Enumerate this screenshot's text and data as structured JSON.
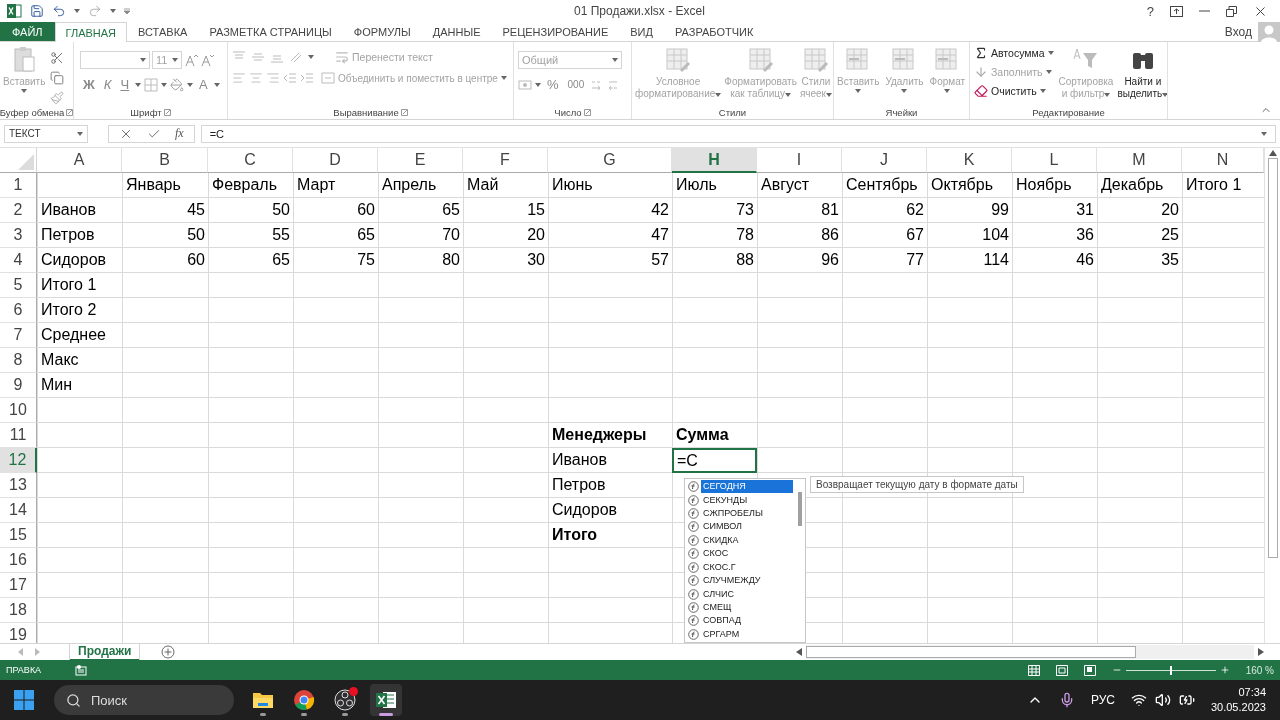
{
  "window": {
    "title": "01 Продажи.xlsx - Excel",
    "help": "?"
  },
  "ribbon_tabs": [
    {
      "label": "ФАЙЛ",
      "kind": "file",
      "selected": false
    },
    {
      "label": "ГЛАВНАЯ",
      "kind": "tab",
      "selected": true
    },
    {
      "label": "ВСТАВКА",
      "kind": "tab",
      "selected": false
    },
    {
      "label": "РАЗМЕТКА СТРАНИЦЫ",
      "kind": "tab",
      "selected": false
    },
    {
      "label": "ФОРМУЛЫ",
      "kind": "tab",
      "selected": false
    },
    {
      "label": "ДАННЫЕ",
      "kind": "tab",
      "selected": false
    },
    {
      "label": "РЕЦЕНЗИРОВАНИЕ",
      "kind": "tab",
      "selected": false
    },
    {
      "label": "ВИД",
      "kind": "tab",
      "selected": false
    },
    {
      "label": "РАЗРАБОТЧИК",
      "kind": "tab",
      "selected": false
    }
  ],
  "account": {
    "label": "Вход"
  },
  "ribbon_groups": [
    {
      "kind": "clipboard",
      "label": "Буфер обмена",
      "buttons": [
        {
          "label": "Вставить",
          "disabled": true
        }
      ]
    },
    {
      "kind": "font",
      "label": "Шрифт",
      "font_size": "11",
      "buttons": [
        {
          "label": "Ж",
          "disabled": true
        },
        {
          "label": "К",
          "disabled": true
        },
        {
          "label": "Ч",
          "disabled": true
        },
        {
          "label": "A",
          "disabled": true
        }
      ]
    },
    {
      "kind": "alignment",
      "label": "Выравнивание",
      "buttons": [
        {
          "label": "Перенести текст",
          "disabled": true
        },
        {
          "label": "Объединить и поместить в центре",
          "disabled": true
        }
      ]
    },
    {
      "kind": "number",
      "label": "Число",
      "format": "Общий",
      "buttons": [
        {
          "label": "%",
          "disabled": true
        },
        {
          "label": "000",
          "disabled": true
        }
      ]
    },
    {
      "kind": "styles",
      "label": "Стили",
      "buttons": [
        {
          "label": "Условное\nформатирование",
          "disabled": true
        },
        {
          "label": "Форматировать\nкак таблицу",
          "disabled": true
        },
        {
          "label": "Стили\nячеек",
          "disabled": true
        }
      ]
    },
    {
      "kind": "cells",
      "label": "Ячейки",
      "buttons": [
        {
          "label": "Вставить",
          "disabled": true
        },
        {
          "label": "Удалить",
          "disabled": true
        },
        {
          "label": "Формат",
          "disabled": true
        }
      ]
    },
    {
      "kind": "editing",
      "label": "Редактирование",
      "buttons": [
        {
          "label": "Автосумма",
          "disabled": false
        },
        {
          "label": "Заполнить",
          "disabled": true
        },
        {
          "label": "Очистить",
          "disabled": false
        },
        {
          "label": "Сортировка\nи фильтр",
          "disabled": true
        },
        {
          "label": "Найти и\nвыделить",
          "disabled": false
        }
      ]
    }
  ],
  "formula_bar": {
    "name_box": "ТЕКСТ",
    "function_label": "fx",
    "value": "=С"
  },
  "columns": [
    {
      "label": "A",
      "selected": false
    },
    {
      "label": "B",
      "selected": false
    },
    {
      "label": "C",
      "selected": false
    },
    {
      "label": "D",
      "selected": false
    },
    {
      "label": "E",
      "selected": false
    },
    {
      "label": "F",
      "selected": false
    },
    {
      "label": "G",
      "selected": false
    },
    {
      "label": "H",
      "selected": true
    },
    {
      "label": "I",
      "selected": false
    },
    {
      "label": "J",
      "selected": false
    },
    {
      "label": "K",
      "selected": false
    },
    {
      "label": "L",
      "selected": false
    },
    {
      "label": "M",
      "selected": false
    },
    {
      "label": "N",
      "selected": false
    }
  ],
  "rows": [
    {
      "number": "1",
      "selected": false,
      "cells": [
        null,
        {
          "text": "Январь",
          "kind": "text"
        },
        {
          "text": "Февраль",
          "kind": "text"
        },
        {
          "text": "Март",
          "kind": "text"
        },
        {
          "text": "Апрель",
          "kind": "text"
        },
        {
          "text": "Май",
          "kind": "text"
        },
        {
          "text": "Июнь",
          "kind": "text"
        },
        {
          "text": "Июль",
          "kind": "text"
        },
        {
          "text": "Август",
          "kind": "text"
        },
        {
          "text": "Сентябрь",
          "kind": "text"
        },
        {
          "text": "Октябрь",
          "kind": "text"
        },
        {
          "text": "Ноябрь",
          "kind": "text"
        },
        {
          "text": "Декабрь",
          "kind": "text"
        },
        {
          "text": "Итого 1",
          "kind": "text"
        }
      ]
    },
    {
      "number": "2",
      "selected": false,
      "cells": [
        {
          "text": "Иванов",
          "kind": "text"
        },
        {
          "text": "45",
          "kind": "number"
        },
        {
          "text": "50",
          "kind": "number"
        },
        {
          "text": "60",
          "kind": "number"
        },
        {
          "text": "65",
          "kind": "number"
        },
        {
          "text": "15",
          "kind": "number"
        },
        {
          "text": "42",
          "kind": "number"
        },
        {
          "text": "73",
          "kind": "number"
        },
        {
          "text": "81",
          "kind": "number"
        },
        {
          "text": "62",
          "kind": "number"
        },
        {
          "text": "99",
          "kind": "number"
        },
        {
          "text": "31",
          "kind": "number"
        },
        {
          "text": "20",
          "kind": "number"
        }
      ]
    },
    {
      "number": "3",
      "selected": false,
      "cells": [
        {
          "text": "Петров",
          "kind": "text"
        },
        {
          "text": "50",
          "kind": "number"
        },
        {
          "text": "55",
          "kind": "number"
        },
        {
          "text": "65",
          "kind": "number"
        },
        {
          "text": "70",
          "kind": "number"
        },
        {
          "text": "20",
          "kind": "number"
        },
        {
          "text": "47",
          "kind": "number"
        },
        {
          "text": "78",
          "kind": "number"
        },
        {
          "text": "86",
          "kind": "number"
        },
        {
          "text": "67",
          "kind": "number"
        },
        {
          "text": "104",
          "kind": "number"
        },
        {
          "text": "36",
          "kind": "number"
        },
        {
          "text": "25",
          "kind": "number"
        }
      ]
    },
    {
      "number": "4",
      "selected": false,
      "cells": [
        {
          "text": "Сидоров",
          "kind": "text"
        },
        {
          "text": "60",
          "kind": "number"
        },
        {
          "text": "65",
          "kind": "number"
        },
        {
          "text": "75",
          "kind": "number"
        },
        {
          "text": "80",
          "kind": "number"
        },
        {
          "text": "30",
          "kind": "number"
        },
        {
          "text": "57",
          "kind": "number"
        },
        {
          "text": "88",
          "kind": "number"
        },
        {
          "text": "96",
          "kind": "number"
        },
        {
          "text": "77",
          "kind": "number"
        },
        {
          "text": "114",
          "kind": "number"
        },
        {
          "text": "46",
          "kind": "number"
        },
        {
          "text": "35",
          "kind": "number"
        }
      ]
    },
    {
      "number": "5",
      "selected": false,
      "cells": [
        {
          "text": "Итого 1",
          "kind": "text"
        }
      ]
    },
    {
      "number": "6",
      "selected": false,
      "cells": [
        {
          "text": "Итого 2",
          "kind": "text"
        }
      ]
    },
    {
      "number": "7",
      "selected": false,
      "cells": [
        {
          "text": "Среднее",
          "kind": "text"
        }
      ]
    },
    {
      "number": "8",
      "selected": false,
      "cells": [
        {
          "text": "Макс",
          "kind": "text"
        }
      ]
    },
    {
      "number": "9",
      "selected": false,
      "cells": [
        {
          "text": "Мин",
          "kind": "text"
        }
      ]
    },
    {
      "number": "10",
      "selected": false,
      "cells": []
    },
    {
      "number": "11",
      "selected": false,
      "cells": [
        null,
        null,
        null,
        null,
        null,
        null,
        {
          "text": "Менеджеры",
          "kind": "bold"
        },
        {
          "text": "Сумма",
          "kind": "bold"
        }
      ]
    },
    {
      "number": "12",
      "selected": true,
      "cells": [
        null,
        null,
        null,
        null,
        null,
        null,
        {
          "text": "Иванов",
          "kind": "text"
        },
        {
          "text": "=С",
          "kind": "editing"
        }
      ]
    },
    {
      "number": "13",
      "selected": false,
      "cells": [
        null,
        null,
        null,
        null,
        null,
        null,
        {
          "text": "Петров",
          "kind": "text"
        }
      ]
    },
    {
      "number": "14",
      "selected": false,
      "cells": [
        null,
        null,
        null,
        null,
        null,
        null,
        {
          "text": "Сидоров",
          "kind": "text"
        }
      ]
    },
    {
      "number": "15",
      "selected": false,
      "cells": [
        null,
        null,
        null,
        null,
        null,
        null,
        {
          "text": "Итого",
          "kind": "bold"
        }
      ]
    },
    {
      "number": "16",
      "selected": false,
      "cells": []
    },
    {
      "number": "17",
      "selected": false,
      "cells": []
    },
    {
      "number": "18",
      "selected": false,
      "cells": []
    },
    {
      "number": "19",
      "selected": false,
      "cells": []
    }
  ],
  "autocomplete": {
    "items": [
      {
        "label": "СЕГОДНЯ",
        "selected": true
      },
      {
        "label": "СЕКУНДЫ",
        "selected": false
      },
      {
        "label": "СЖПРОБЕЛЫ",
        "selected": false
      },
      {
        "label": "СИМВОЛ",
        "selected": false
      },
      {
        "label": "СКИДКА",
        "selected": false
      },
      {
        "label": "СКОС",
        "selected": false
      },
      {
        "label": "СКОС.Г",
        "selected": false
      },
      {
        "label": "СЛУЧМЕЖДУ",
        "selected": false
      },
      {
        "label": "СЛЧИС",
        "selected": false
      },
      {
        "label": "СМЕЩ",
        "selected": false
      },
      {
        "label": "СОВПАД",
        "selected": false
      },
      {
        "label": "СРГАРМ",
        "selected": false
      }
    ],
    "tooltip": "Возвращает текущую дату в формате даты"
  },
  "sheet_tabs": [
    {
      "label": "Продажи",
      "selected": true
    }
  ],
  "status_bar": {
    "mode": "ПРАВКА",
    "zoom": "160 %",
    "zoom_slider": {
      "level": 0.5
    }
  },
  "taskbar": {
    "search": {
      "placeholder": "Поиск"
    },
    "apps": [
      {
        "kind": "folder",
        "selected": false,
        "badge": false
      },
      {
        "kind": "browser",
        "selected": false,
        "badge": false
      },
      {
        "kind": "recorder",
        "selected": false,
        "badge": true
      },
      {
        "kind": "spreadsheet",
        "selected": true,
        "badge": false
      }
    ],
    "language": "РУС",
    "time": "07:34",
    "date": "30.05.2023"
  }
}
